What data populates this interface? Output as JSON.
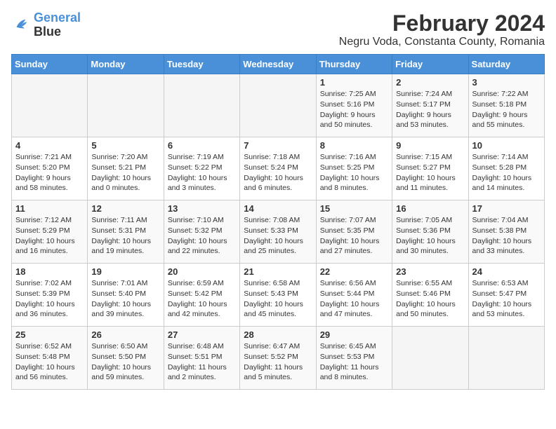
{
  "header": {
    "logo_line1": "General",
    "logo_line2": "Blue",
    "title": "February 2024",
    "subtitle": "Negru Voda, Constanta County, Romania"
  },
  "weekdays": [
    "Sunday",
    "Monday",
    "Tuesday",
    "Wednesday",
    "Thursday",
    "Friday",
    "Saturday"
  ],
  "weeks": [
    [
      {
        "day": "",
        "info": ""
      },
      {
        "day": "",
        "info": ""
      },
      {
        "day": "",
        "info": ""
      },
      {
        "day": "",
        "info": ""
      },
      {
        "day": "1",
        "info": "Sunrise: 7:25 AM\nSunset: 5:16 PM\nDaylight: 9 hours\nand 50 minutes."
      },
      {
        "day": "2",
        "info": "Sunrise: 7:24 AM\nSunset: 5:17 PM\nDaylight: 9 hours\nand 53 minutes."
      },
      {
        "day": "3",
        "info": "Sunrise: 7:22 AM\nSunset: 5:18 PM\nDaylight: 9 hours\nand 55 minutes."
      }
    ],
    [
      {
        "day": "4",
        "info": "Sunrise: 7:21 AM\nSunset: 5:20 PM\nDaylight: 9 hours\nand 58 minutes."
      },
      {
        "day": "5",
        "info": "Sunrise: 7:20 AM\nSunset: 5:21 PM\nDaylight: 10 hours\nand 0 minutes."
      },
      {
        "day": "6",
        "info": "Sunrise: 7:19 AM\nSunset: 5:22 PM\nDaylight: 10 hours\nand 3 minutes."
      },
      {
        "day": "7",
        "info": "Sunrise: 7:18 AM\nSunset: 5:24 PM\nDaylight: 10 hours\nand 6 minutes."
      },
      {
        "day": "8",
        "info": "Sunrise: 7:16 AM\nSunset: 5:25 PM\nDaylight: 10 hours\nand 8 minutes."
      },
      {
        "day": "9",
        "info": "Sunrise: 7:15 AM\nSunset: 5:27 PM\nDaylight: 10 hours\nand 11 minutes."
      },
      {
        "day": "10",
        "info": "Sunrise: 7:14 AM\nSunset: 5:28 PM\nDaylight: 10 hours\nand 14 minutes."
      }
    ],
    [
      {
        "day": "11",
        "info": "Sunrise: 7:12 AM\nSunset: 5:29 PM\nDaylight: 10 hours\nand 16 minutes."
      },
      {
        "day": "12",
        "info": "Sunrise: 7:11 AM\nSunset: 5:31 PM\nDaylight: 10 hours\nand 19 minutes."
      },
      {
        "day": "13",
        "info": "Sunrise: 7:10 AM\nSunset: 5:32 PM\nDaylight: 10 hours\nand 22 minutes."
      },
      {
        "day": "14",
        "info": "Sunrise: 7:08 AM\nSunset: 5:33 PM\nDaylight: 10 hours\nand 25 minutes."
      },
      {
        "day": "15",
        "info": "Sunrise: 7:07 AM\nSunset: 5:35 PM\nDaylight: 10 hours\nand 27 minutes."
      },
      {
        "day": "16",
        "info": "Sunrise: 7:05 AM\nSunset: 5:36 PM\nDaylight: 10 hours\nand 30 minutes."
      },
      {
        "day": "17",
        "info": "Sunrise: 7:04 AM\nSunset: 5:38 PM\nDaylight: 10 hours\nand 33 minutes."
      }
    ],
    [
      {
        "day": "18",
        "info": "Sunrise: 7:02 AM\nSunset: 5:39 PM\nDaylight: 10 hours\nand 36 minutes."
      },
      {
        "day": "19",
        "info": "Sunrise: 7:01 AM\nSunset: 5:40 PM\nDaylight: 10 hours\nand 39 minutes."
      },
      {
        "day": "20",
        "info": "Sunrise: 6:59 AM\nSunset: 5:42 PM\nDaylight: 10 hours\nand 42 minutes."
      },
      {
        "day": "21",
        "info": "Sunrise: 6:58 AM\nSunset: 5:43 PM\nDaylight: 10 hours\nand 45 minutes."
      },
      {
        "day": "22",
        "info": "Sunrise: 6:56 AM\nSunset: 5:44 PM\nDaylight: 10 hours\nand 47 minutes."
      },
      {
        "day": "23",
        "info": "Sunrise: 6:55 AM\nSunset: 5:46 PM\nDaylight: 10 hours\nand 50 minutes."
      },
      {
        "day": "24",
        "info": "Sunrise: 6:53 AM\nSunset: 5:47 PM\nDaylight: 10 hours\nand 53 minutes."
      }
    ],
    [
      {
        "day": "25",
        "info": "Sunrise: 6:52 AM\nSunset: 5:48 PM\nDaylight: 10 hours\nand 56 minutes."
      },
      {
        "day": "26",
        "info": "Sunrise: 6:50 AM\nSunset: 5:50 PM\nDaylight: 10 hours\nand 59 minutes."
      },
      {
        "day": "27",
        "info": "Sunrise: 6:48 AM\nSunset: 5:51 PM\nDaylight: 11 hours\nand 2 minutes."
      },
      {
        "day": "28",
        "info": "Sunrise: 6:47 AM\nSunset: 5:52 PM\nDaylight: 11 hours\nand 5 minutes."
      },
      {
        "day": "29",
        "info": "Sunrise: 6:45 AM\nSunset: 5:53 PM\nDaylight: 11 hours\nand 8 minutes."
      },
      {
        "day": "",
        "info": ""
      },
      {
        "day": "",
        "info": ""
      }
    ]
  ]
}
